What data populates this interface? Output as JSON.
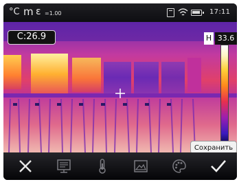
{
  "status_bar": {
    "unit_celsius": "°C",
    "unit_m": "m",
    "emissivity_symbol": "ε",
    "emissivity_value": "=1.00",
    "time": "17:11",
    "icons": [
      "sd-card-icon",
      "wifi-icon",
      "battery-icon"
    ]
  },
  "thermal_view": {
    "center_temperature": "C:26.9",
    "palette": "iron",
    "crosshair_icon": "crosshair-icon"
  },
  "scale": {
    "mode_label": "H",
    "max_temperature": "33.6"
  },
  "actions": {
    "save_label": "Сохранить"
  },
  "toolbar": {
    "buttons": [
      "close-icon",
      "report-icon",
      "thermometer-icon",
      "image-icon",
      "palette-icon",
      "checkmark-icon"
    ]
  }
}
